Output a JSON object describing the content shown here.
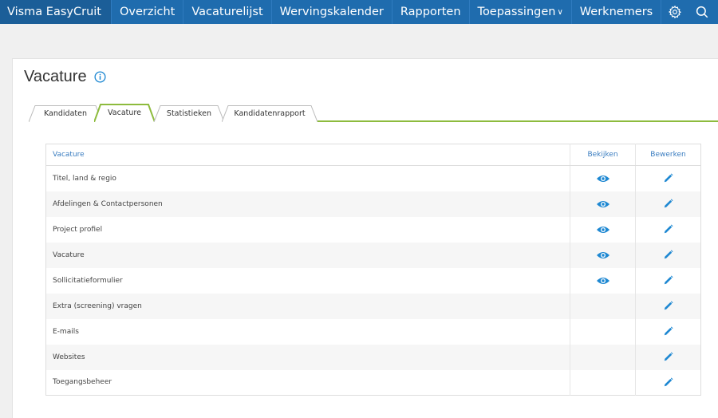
{
  "app": {
    "brand": "Visma EasyCruit"
  },
  "nav": {
    "items": [
      {
        "label": "Overzicht"
      },
      {
        "label": "Vacaturelijst"
      },
      {
        "label": "Wervingskalender"
      },
      {
        "label": "Rapporten"
      },
      {
        "label": "Toepassingen",
        "dropdown": true
      },
      {
        "label": "Werknemers"
      }
    ],
    "icons": [
      "gear-icon",
      "search-icon"
    ]
  },
  "page": {
    "title": "Vacature",
    "title_icon": "info-icon"
  },
  "tabs": [
    {
      "label": "Kandidaten",
      "active": false
    },
    {
      "label": "Vacature",
      "active": true
    },
    {
      "label": "Statistieken",
      "active": false
    },
    {
      "label": "Kandidatenrapport",
      "active": false
    }
  ],
  "table": {
    "headers": {
      "name": "Vacature",
      "view": "Bekijken",
      "edit": "Bewerken"
    },
    "rows": [
      {
        "label": "Titel, land & regio",
        "view": true,
        "edit": true
      },
      {
        "label": "Afdelingen & Contactpersonen",
        "view": true,
        "edit": true
      },
      {
        "label": "Project profiel",
        "view": true,
        "edit": true
      },
      {
        "label": "Vacature",
        "view": true,
        "edit": true
      },
      {
        "label": "Sollicitatieformulier",
        "view": true,
        "edit": true
      },
      {
        "label": "Extra (screening) vragen",
        "view": false,
        "edit": true
      },
      {
        "label": "E-mails",
        "view": false,
        "edit": true
      },
      {
        "label": "Websites",
        "view": false,
        "edit": true
      },
      {
        "label": "Toegangsbeheer",
        "view": false,
        "edit": true
      }
    ]
  },
  "colors": {
    "nav": "#1f6cae",
    "brand_bg": "#1b5e98",
    "accent": "#3a7dc0",
    "icon": "#1e88d2",
    "tab_line": "#8dbb3d"
  }
}
